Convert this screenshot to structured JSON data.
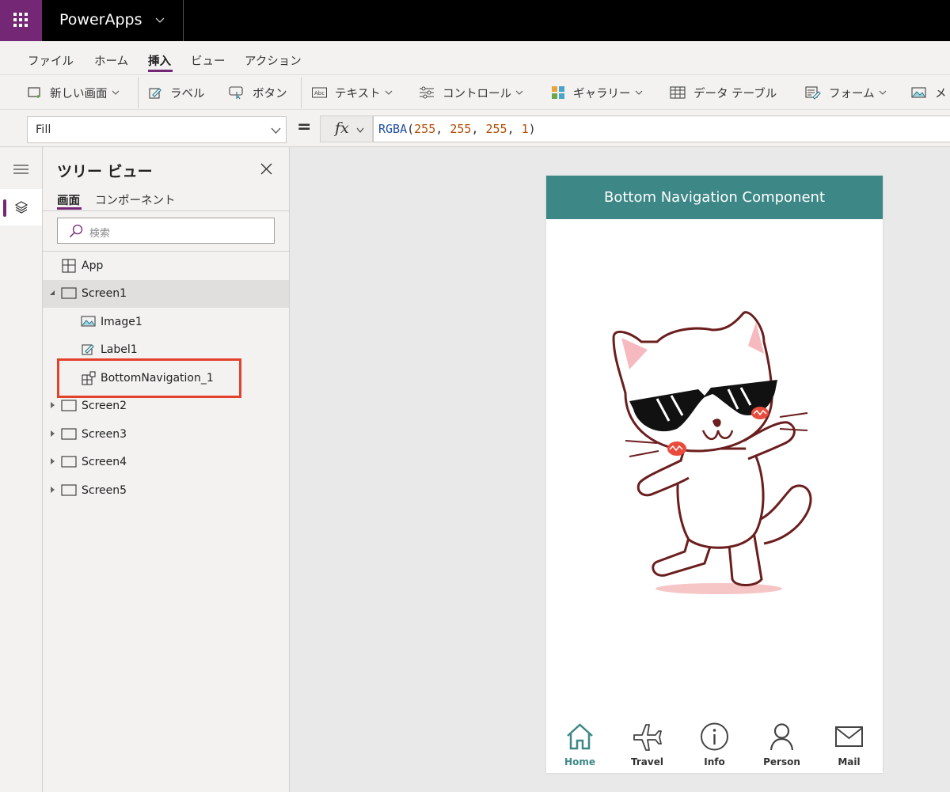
{
  "app": {
    "name": "PowerApps"
  },
  "menu": {
    "tabs": [
      "ファイル",
      "ホーム",
      "挿入",
      "ビュー",
      "アクション"
    ],
    "active_tab": "挿入"
  },
  "ribbon": {
    "new_screen": "新しい画面",
    "label": "ラベル",
    "button": "ボタン",
    "text": "テキスト",
    "controls": "コントロール",
    "gallery": "ギャラリー",
    "data_table": "データ テーブル",
    "form": "フォーム",
    "media_partial": "メ"
  },
  "formula": {
    "property": "Fill",
    "fx_label": "fx",
    "fn": "RGBA",
    "args": [
      "255",
      "255",
      "255",
      "1"
    ]
  },
  "tree": {
    "title": "ツリー ビュー",
    "tabs": [
      "画面",
      "コンポーネント"
    ],
    "search_placeholder": "検索",
    "nodes": [
      "App",
      "Screen1",
      "Image1",
      "Label1",
      "BottomNavigation_1",
      "Screen2",
      "Screen3",
      "Screen4",
      "Screen5"
    ],
    "selected": "Screen1"
  },
  "phone": {
    "header": "Bottom Navigation Component",
    "nav": [
      "Home",
      "Travel",
      "Info",
      "Person",
      "Mail"
    ],
    "active_nav": "Home"
  },
  "colors": {
    "brand": "#742774",
    "header_teal": "#3d8787",
    "highlight": "#e2412b"
  }
}
